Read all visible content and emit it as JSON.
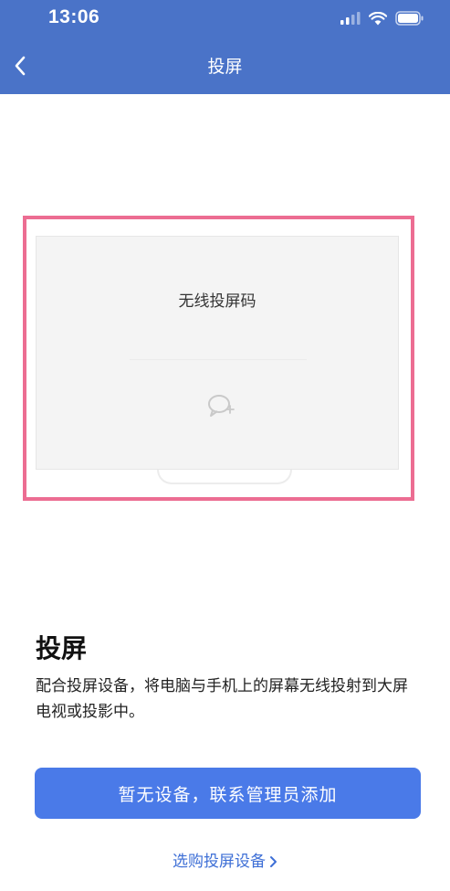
{
  "status_bar": {
    "time": "13:06",
    "icons": [
      "signal-icon",
      "wifi-icon",
      "battery-icon"
    ]
  },
  "nav": {
    "back_icon": "chevron-left-icon",
    "title": "投屏"
  },
  "preview": {
    "code_label": "无线投屏码",
    "icon": "chat-bubble-icon"
  },
  "content": {
    "title": "投屏",
    "description": "配合投屏设备，将电脑与手机上的屏幕无线投射到大屏电视或投影中。"
  },
  "actions": {
    "primary_label": "暂无设备，联系管理员添加",
    "link_label": "选购投屏设备"
  },
  "colors": {
    "header_bg": "#4a73c8",
    "primary_button": "#4a7ae8",
    "link": "#3e6fd6",
    "highlight_frame": "#ec6d92"
  }
}
